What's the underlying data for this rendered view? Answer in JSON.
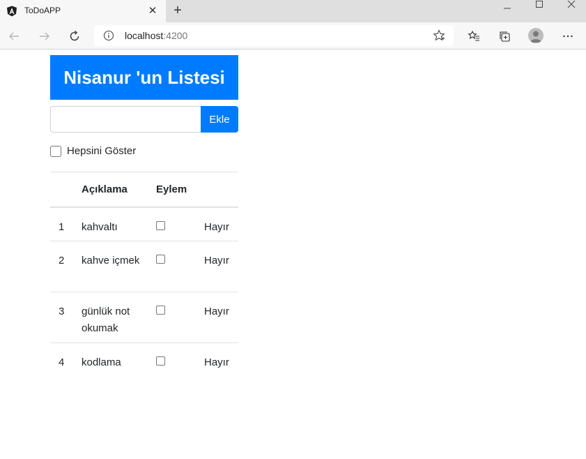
{
  "browser": {
    "tab_title": "ToDoAPP",
    "new_tab_symbol": "+",
    "close_symbol": "✕",
    "url_host": "localhost",
    "url_port": ":4200",
    "window_controls": {
      "minimize": "—",
      "maximize": "☐",
      "close": "✕"
    }
  },
  "app": {
    "title": "Nisanur 'un Listesi",
    "input_value": "",
    "add_label": "Ekle",
    "show_all_label": "Hepsini Göster",
    "table": {
      "headers": [
        "",
        "Açıklama",
        "Eylem",
        ""
      ],
      "rows": [
        {
          "num": "1",
          "desc": "kahvaltı",
          "status": "Hayır"
        },
        {
          "num": "2",
          "desc": "kahve içmek",
          "status": "Hayır"
        },
        {
          "num": "3",
          "desc": "günlük not okumak",
          "status": "Hayır"
        },
        {
          "num": "4",
          "desc": "kodlama",
          "status": "Hayır"
        }
      ]
    }
  },
  "colors": {
    "primary": "#007bff",
    "border": "#dee2e6",
    "text": "#212529"
  }
}
